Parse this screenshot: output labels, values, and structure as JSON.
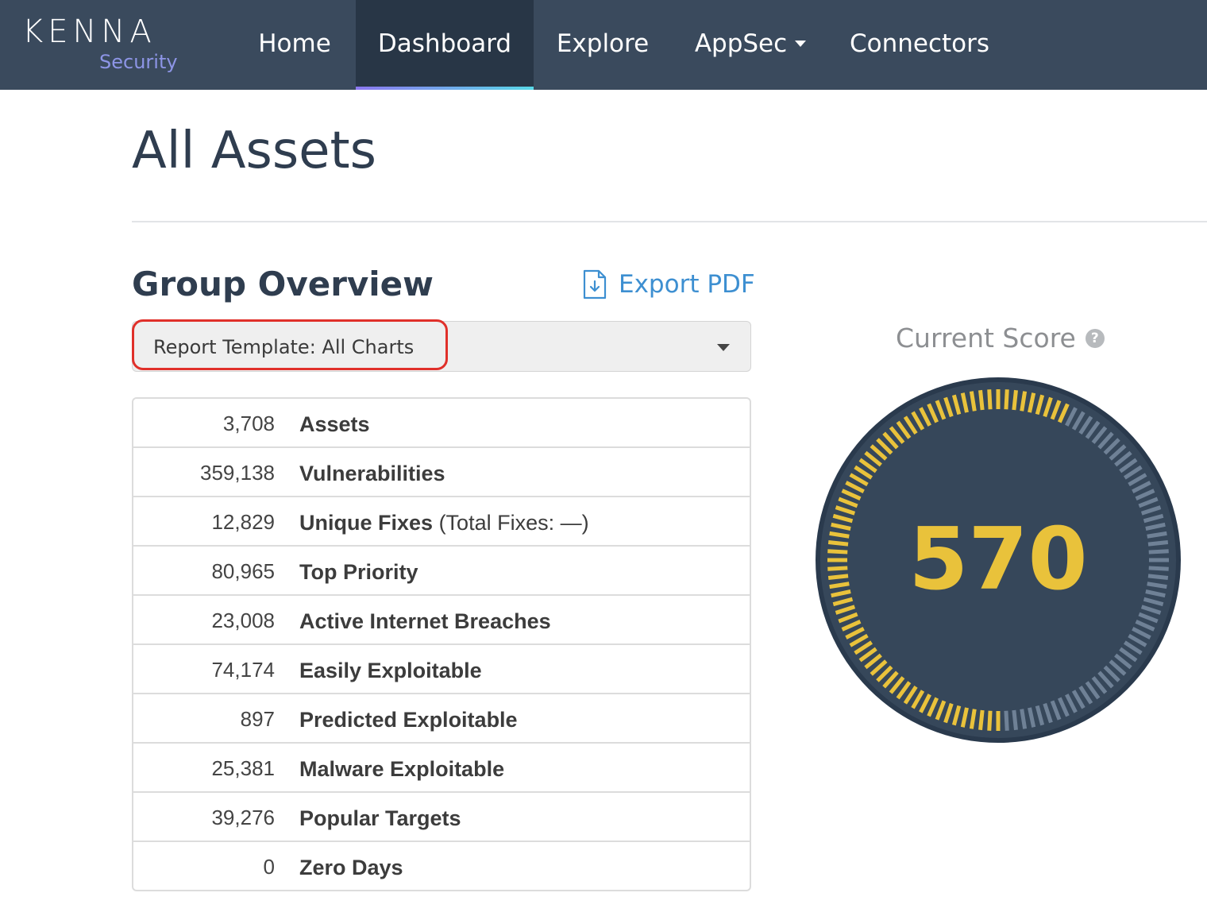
{
  "brand": {
    "name": "KENNA",
    "sub": "Security"
  },
  "nav": {
    "items": [
      {
        "label": "Home"
      },
      {
        "label": "Dashboard"
      },
      {
        "label": "Explore"
      },
      {
        "label": "AppSec"
      },
      {
        "label": "Connectors"
      }
    ],
    "active": "Dashboard"
  },
  "page": {
    "title": "All Assets"
  },
  "overview": {
    "title": "Group Overview",
    "export_label": "Export PDF",
    "template_select": "Report Template: All Charts",
    "stats": [
      {
        "value": "3,708",
        "label": "Assets",
        "extra": ""
      },
      {
        "value": "359,138",
        "label": "Vulnerabilities",
        "extra": ""
      },
      {
        "value": "12,829",
        "label": "Unique Fixes",
        "extra": "(Total Fixes: —)"
      },
      {
        "value": "80,965",
        "label": "Top Priority",
        "extra": ""
      },
      {
        "value": "23,008",
        "label": "Active Internet Breaches",
        "extra": ""
      },
      {
        "value": "74,174",
        "label": "Easily Exploitable",
        "extra": ""
      },
      {
        "value": "897",
        "label": "Predicted Exploitable",
        "extra": ""
      },
      {
        "value": "25,381",
        "label": "Malware Exploitable",
        "extra": ""
      },
      {
        "value": "39,276",
        "label": "Popular Targets",
        "extra": ""
      },
      {
        "value": "0",
        "label": "Zero Days",
        "extra": ""
      }
    ]
  },
  "score": {
    "title": "Current Score",
    "value": "570",
    "score_max": 1000,
    "colors": {
      "fill": "#e9c23b",
      "track": "#6f8196",
      "dial": "#36475a",
      "ring": "#2a3a4d"
    }
  }
}
